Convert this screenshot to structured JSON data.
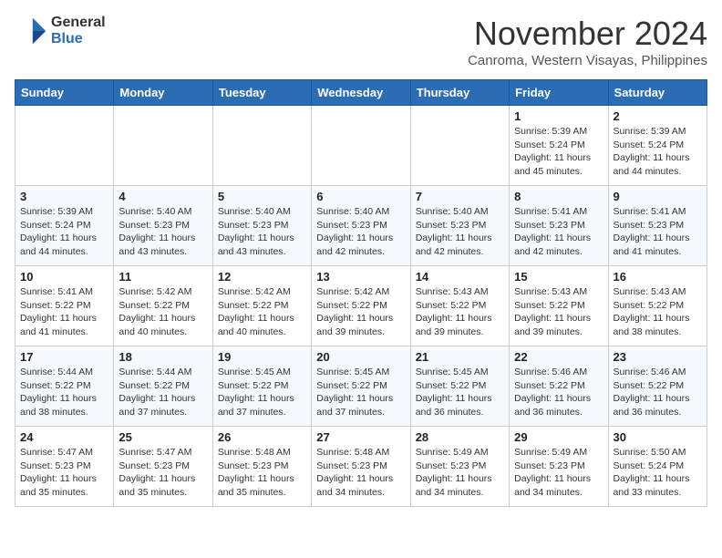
{
  "logo": {
    "general": "General",
    "blue": "Blue"
  },
  "header": {
    "month": "November 2024",
    "location": "Canroma, Western Visayas, Philippines"
  },
  "weekdays": [
    "Sunday",
    "Monday",
    "Tuesday",
    "Wednesday",
    "Thursday",
    "Friday",
    "Saturday"
  ],
  "weeks": [
    [
      {
        "day": "",
        "info": ""
      },
      {
        "day": "",
        "info": ""
      },
      {
        "day": "",
        "info": ""
      },
      {
        "day": "",
        "info": ""
      },
      {
        "day": "",
        "info": ""
      },
      {
        "day": "1",
        "info": "Sunrise: 5:39 AM\nSunset: 5:24 PM\nDaylight: 11 hours\nand 45 minutes."
      },
      {
        "day": "2",
        "info": "Sunrise: 5:39 AM\nSunset: 5:24 PM\nDaylight: 11 hours\nand 44 minutes."
      }
    ],
    [
      {
        "day": "3",
        "info": "Sunrise: 5:39 AM\nSunset: 5:24 PM\nDaylight: 11 hours\nand 44 minutes."
      },
      {
        "day": "4",
        "info": "Sunrise: 5:40 AM\nSunset: 5:23 PM\nDaylight: 11 hours\nand 43 minutes."
      },
      {
        "day": "5",
        "info": "Sunrise: 5:40 AM\nSunset: 5:23 PM\nDaylight: 11 hours\nand 43 minutes."
      },
      {
        "day": "6",
        "info": "Sunrise: 5:40 AM\nSunset: 5:23 PM\nDaylight: 11 hours\nand 42 minutes."
      },
      {
        "day": "7",
        "info": "Sunrise: 5:40 AM\nSunset: 5:23 PM\nDaylight: 11 hours\nand 42 minutes."
      },
      {
        "day": "8",
        "info": "Sunrise: 5:41 AM\nSunset: 5:23 PM\nDaylight: 11 hours\nand 42 minutes."
      },
      {
        "day": "9",
        "info": "Sunrise: 5:41 AM\nSunset: 5:23 PM\nDaylight: 11 hours\nand 41 minutes."
      }
    ],
    [
      {
        "day": "10",
        "info": "Sunrise: 5:41 AM\nSunset: 5:22 PM\nDaylight: 11 hours\nand 41 minutes."
      },
      {
        "day": "11",
        "info": "Sunrise: 5:42 AM\nSunset: 5:22 PM\nDaylight: 11 hours\nand 40 minutes."
      },
      {
        "day": "12",
        "info": "Sunrise: 5:42 AM\nSunset: 5:22 PM\nDaylight: 11 hours\nand 40 minutes."
      },
      {
        "day": "13",
        "info": "Sunrise: 5:42 AM\nSunset: 5:22 PM\nDaylight: 11 hours\nand 39 minutes."
      },
      {
        "day": "14",
        "info": "Sunrise: 5:43 AM\nSunset: 5:22 PM\nDaylight: 11 hours\nand 39 minutes."
      },
      {
        "day": "15",
        "info": "Sunrise: 5:43 AM\nSunset: 5:22 PM\nDaylight: 11 hours\nand 39 minutes."
      },
      {
        "day": "16",
        "info": "Sunrise: 5:43 AM\nSunset: 5:22 PM\nDaylight: 11 hours\nand 38 minutes."
      }
    ],
    [
      {
        "day": "17",
        "info": "Sunrise: 5:44 AM\nSunset: 5:22 PM\nDaylight: 11 hours\nand 38 minutes."
      },
      {
        "day": "18",
        "info": "Sunrise: 5:44 AM\nSunset: 5:22 PM\nDaylight: 11 hours\nand 37 minutes."
      },
      {
        "day": "19",
        "info": "Sunrise: 5:45 AM\nSunset: 5:22 PM\nDaylight: 11 hours\nand 37 minutes."
      },
      {
        "day": "20",
        "info": "Sunrise: 5:45 AM\nSunset: 5:22 PM\nDaylight: 11 hours\nand 37 minutes."
      },
      {
        "day": "21",
        "info": "Sunrise: 5:45 AM\nSunset: 5:22 PM\nDaylight: 11 hours\nand 36 minutes."
      },
      {
        "day": "22",
        "info": "Sunrise: 5:46 AM\nSunset: 5:22 PM\nDaylight: 11 hours\nand 36 minutes."
      },
      {
        "day": "23",
        "info": "Sunrise: 5:46 AM\nSunset: 5:22 PM\nDaylight: 11 hours\nand 36 minutes."
      }
    ],
    [
      {
        "day": "24",
        "info": "Sunrise: 5:47 AM\nSunset: 5:23 PM\nDaylight: 11 hours\nand 35 minutes."
      },
      {
        "day": "25",
        "info": "Sunrise: 5:47 AM\nSunset: 5:23 PM\nDaylight: 11 hours\nand 35 minutes."
      },
      {
        "day": "26",
        "info": "Sunrise: 5:48 AM\nSunset: 5:23 PM\nDaylight: 11 hours\nand 35 minutes."
      },
      {
        "day": "27",
        "info": "Sunrise: 5:48 AM\nSunset: 5:23 PM\nDaylight: 11 hours\nand 34 minutes."
      },
      {
        "day": "28",
        "info": "Sunrise: 5:49 AM\nSunset: 5:23 PM\nDaylight: 11 hours\nand 34 minutes."
      },
      {
        "day": "29",
        "info": "Sunrise: 5:49 AM\nSunset: 5:23 PM\nDaylight: 11 hours\nand 34 minutes."
      },
      {
        "day": "30",
        "info": "Sunrise: 5:50 AM\nSunset: 5:24 PM\nDaylight: 11 hours\nand 33 minutes."
      }
    ]
  ]
}
